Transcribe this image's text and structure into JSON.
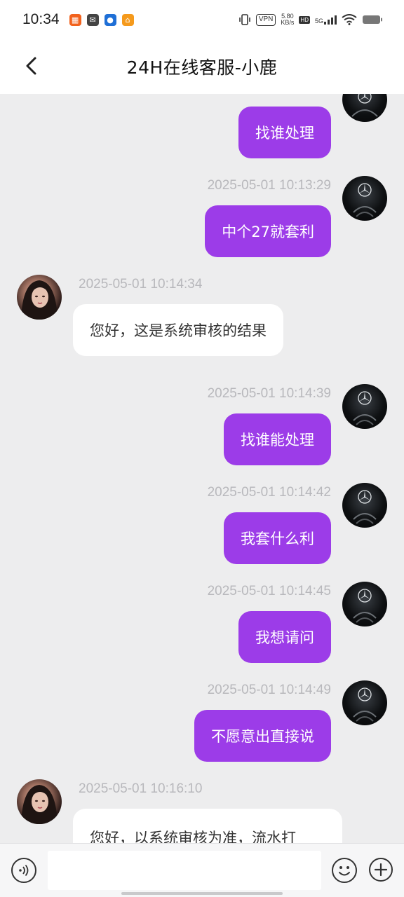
{
  "status_bar": {
    "time": "10:34",
    "vpn": "VPN",
    "speed_value": "5.80",
    "speed_unit": "KB/s",
    "hd": "HD",
    "network": "5G"
  },
  "header": {
    "title": "24H在线客服-小鹿"
  },
  "messages": [
    {
      "side": "out",
      "timestamp": "",
      "text": "找谁处理"
    },
    {
      "side": "out",
      "timestamp": "2025-05-01 10:13:29",
      "text": "中个27就套利"
    },
    {
      "side": "in",
      "timestamp": "2025-05-01 10:14:34",
      "text": "您好，这是系统审核的结果"
    },
    {
      "side": "out",
      "timestamp": "2025-05-01 10:14:39",
      "text": "找谁能处理"
    },
    {
      "side": "out",
      "timestamp": "2025-05-01 10:14:42",
      "text": "我套什么利"
    },
    {
      "side": "out",
      "timestamp": "2025-05-01 10:14:45",
      "text": "我想请问"
    },
    {
      "side": "out",
      "timestamp": "2025-05-01 10:14:49",
      "text": "不愿意出直接说"
    },
    {
      "side": "in",
      "timestamp": "2025-05-01 10:16:10",
      "text": "您好，以系统审核为准，流水打"
    }
  ],
  "input": {
    "value": "",
    "placeholder": ""
  },
  "colors": {
    "outgoing_bubble": "#9c3ce8",
    "incoming_bubble": "#ffffff",
    "chat_background": "#ededee"
  }
}
